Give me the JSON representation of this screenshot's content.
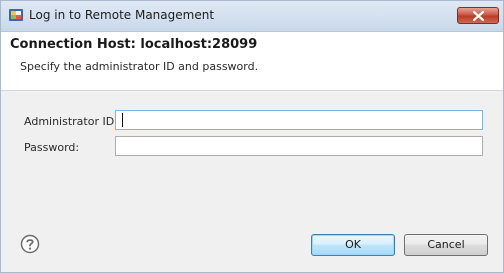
{
  "window": {
    "title": "Log in to Remote Management"
  },
  "header": {
    "title": "Connection Host: localhost:28099",
    "message": "Specify the administrator ID and password."
  },
  "form": {
    "admin_id_label": "Administrator ID:",
    "admin_id_value": "",
    "password_label": "Password:",
    "password_value": ""
  },
  "buttons": {
    "ok_label": "OK",
    "cancel_label": "Cancel"
  },
  "icons": {
    "app": "app-icon",
    "close": "close-icon",
    "help": "help-icon"
  },
  "colors": {
    "titlebar": "#c9d8ea",
    "close_button": "#c7523f",
    "default_button_border": "#3c7fb1"
  }
}
